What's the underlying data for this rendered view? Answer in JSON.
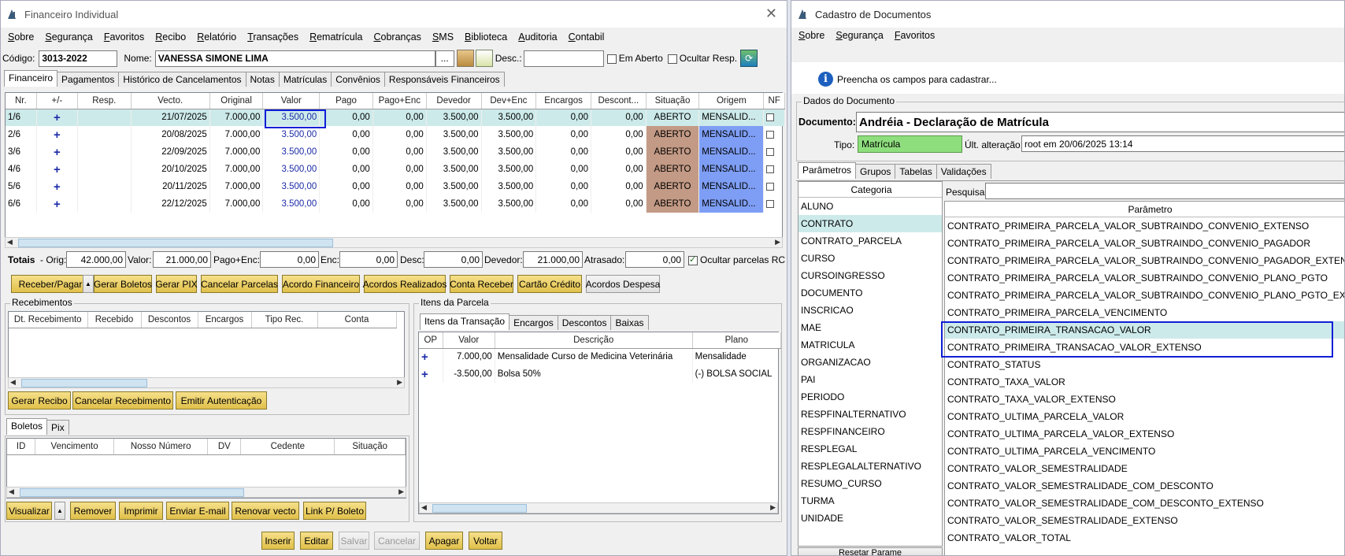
{
  "w1": {
    "title": "Financeiro Individual",
    "menu": [
      "Sobre",
      "Segurança",
      "Favoritos",
      "Recibo",
      "Relatório",
      "Transações",
      "Rematrícula",
      "Cobranças",
      "SMS",
      "Biblioteca",
      "Auditoria",
      "Contabil"
    ],
    "codigo_label": "Código:",
    "codigo": "3013-2022",
    "nome_label": "Nome:",
    "nome": "VANESSA SIMONE LIMA",
    "ellipsis": "...",
    "desc_label": "Desc.:",
    "em_aberto": "Em Aberto",
    "ocultar_resp": "Ocultar Resp.",
    "tabs": [
      "Financeiro",
      "Pagamentos",
      "Histórico de Cancelamentos",
      "Notas",
      "Matrículas",
      "Convênios",
      "Responsáveis Financeiros"
    ],
    "columns": [
      "Nr.",
      "+/-",
      "Resp.",
      "Vecto.",
      "Original",
      "Valor",
      "Pago",
      "Pago+Enc",
      "Devedor",
      "Dev+Enc",
      "Encargos",
      "Descont...",
      "Situação",
      "Origem",
      "NF"
    ],
    "rows": [
      [
        "1/6",
        "+",
        "",
        "21/07/2025",
        "7.000,00",
        "3.500,00",
        "0,00",
        "0,00",
        "3.500,00",
        "3.500,00",
        "0,00",
        "0,00",
        "ABERTO",
        "MENSALID..."
      ],
      [
        "2/6",
        "+",
        "",
        "20/08/2025",
        "7.000,00",
        "3.500,00",
        "0,00",
        "0,00",
        "3.500,00",
        "3.500,00",
        "0,00",
        "0,00",
        "ABERTO",
        "MENSALID..."
      ],
      [
        "3/6",
        "+",
        "",
        "22/09/2025",
        "7.000,00",
        "3.500,00",
        "0,00",
        "0,00",
        "3.500,00",
        "3.500,00",
        "0,00",
        "0,00",
        "ABERTO",
        "MENSALID..."
      ],
      [
        "4/6",
        "+",
        "",
        "20/10/2025",
        "7.000,00",
        "3.500,00",
        "0,00",
        "0,00",
        "3.500,00",
        "3.500,00",
        "0,00",
        "0,00",
        "ABERTO",
        "MENSALID..."
      ],
      [
        "5/6",
        "+",
        "",
        "20/11/2025",
        "7.000,00",
        "3.500,00",
        "0,00",
        "0,00",
        "3.500,00",
        "3.500,00",
        "0,00",
        "0,00",
        "ABERTO",
        "MENSALID..."
      ],
      [
        "6/6",
        "+",
        "",
        "22/12/2025",
        "7.000,00",
        "3.500,00",
        "0,00",
        "0,00",
        "3.500,00",
        "3.500,00",
        "0,00",
        "0,00",
        "ABERTO",
        "MENSALID..."
      ]
    ],
    "totais": {
      "label": "Totais",
      "orig_label": "- Orig:",
      "orig": "42.000,00",
      "valor_label": "Valor:",
      "valor": "21.000,00",
      "pagoenc_label": "Pago+Enc:",
      "pagoenc": "0,00",
      "enc_label": "Enc:",
      "enc": "0,00",
      "desc_label": "Desc:",
      "desc": "0,00",
      "devedor_label": "Devedor:",
      "devedor": "21.000,00",
      "atrasado_label": "Atrasado:",
      "atrasado": "0,00",
      "ocultar": "Ocultar parcelas RC"
    },
    "actions": [
      "Receber/Pagar",
      "Gerar Boletos",
      "Gerar PIX",
      "Cancelar Parcelas",
      "Acordo Financeiro",
      "Acordos Realizados",
      "Conta Receber",
      "Cartão Crédito",
      "Acordos Despesa"
    ],
    "recebimentos": {
      "title": "Recebimentos",
      "columns": [
        "Dt. Recebimento",
        "Recebido",
        "Descontos",
        "Encargos",
        "Tipo Rec.",
        "Conta"
      ]
    },
    "rec_buttons": [
      "Gerar Recibo",
      "Cancelar Recebimento",
      "Emitir Autenticação"
    ],
    "itens": {
      "title": "Itens da Parcela",
      "tabs": [
        "Itens da Transação",
        "Encargos",
        "Descontos",
        "Baixas"
      ],
      "columns": [
        "OP",
        "Valor",
        "Descrição",
        "Plano"
      ],
      "rows": [
        [
          "+",
          "7.000,00",
          "Mensalidade Curso de Medicina Veterinária",
          "Mensalidade"
        ],
        [
          "+",
          "-3.500,00",
          "Bolsa 50%",
          "(-) BOLSA SOCIAL"
        ]
      ]
    },
    "boletos": {
      "tabs": [
        "Boletos",
        "Pix"
      ],
      "columns": [
        "ID",
        "Vencimento",
        "Nosso Número",
        "DV",
        "Cedente",
        "Situação"
      ]
    },
    "bol_buttons": [
      "Visualizar",
      "Remover",
      "Imprimir",
      "Enviar E-mail",
      "Renovar vecto",
      "Link P/ Boleto"
    ],
    "footer_buttons": [
      "Inserir",
      "Editar",
      "Salvar",
      "Cancelar",
      "Apagar",
      "Voltar"
    ]
  },
  "w2": {
    "title": "Cadastro de Documentos",
    "menu": [
      "Sobre",
      "Segurança",
      "Favoritos"
    ],
    "info": "Preencha os campos para cadastrar...",
    "group": "Dados do Documento",
    "doc_label": "Documento:",
    "doc": "Andréia - Declaração de Matrícula",
    "tipo_label": "Tipo:",
    "tipo": "Matrícula",
    "ult_label": "Últ. alteração:",
    "ult": "root em 20/06/2025 13:14",
    "tabs": [
      "Parâmetros",
      "Grupos",
      "Tabelas",
      "Validações"
    ],
    "categoria_header": "Categoria",
    "pesquisar_label": "Pesquisar:",
    "parametro_header": "Parâmetro",
    "categorias": [
      "ALUNO",
      "CONTRATO",
      "CONTRATO_PARCELA",
      "CURSO",
      "CURSOINGRESSO",
      "DOCUMENTO",
      "INSCRICAO",
      "MAE",
      "MATRICULA",
      "ORGANIZACAO",
      "PAI",
      "PERIODO",
      "RESPFINALTERNATIVO",
      "RESPFINANCEIRO",
      "RESPLEGAL",
      "RESPLEGALALTERNATIVO",
      "RESUMO_CURSO",
      "TURMA",
      "UNIDADE"
    ],
    "parametros": [
      "CONTRATO_PRIMEIRA_PARCELA_VALOR_SUBTRAINDO_CONVENIO_EXTENSO",
      "CONTRATO_PRIMEIRA_PARCELA_VALOR_SUBTRAINDO_CONVENIO_PAGADOR",
      "CONTRATO_PRIMEIRA_PARCELA_VALOR_SUBTRAINDO_CONVENIO_PAGADOR_EXTENSO",
      "CONTRATO_PRIMEIRA_PARCELA_VALOR_SUBTRAINDO_CONVENIO_PLANO_PGTO",
      "CONTRATO_PRIMEIRA_PARCELA_VALOR_SUBTRAINDO_CONVENIO_PLANO_PGTO_EXTENSO",
      "CONTRATO_PRIMEIRA_PARCELA_VENCIMENTO",
      "CONTRATO_PRIMEIRA_TRANSACAO_VALOR",
      "CONTRATO_PRIMEIRA_TRANSACAO_VALOR_EXTENSO",
      "CONTRATO_STATUS",
      "CONTRATO_TAXA_VALOR",
      "CONTRATO_TAXA_VALOR_EXTENSO",
      "CONTRATO_ULTIMA_PARCELA_VALOR",
      "CONTRATO_ULTIMA_PARCELA_VALOR_EXTENSO",
      "CONTRATO_ULTIMA_PARCELA_VENCIMENTO",
      "CONTRATO_VALOR_SEMESTRALIDADE",
      "CONTRATO_VALOR_SEMESTRALIDADE_COM_DESCONTO",
      "CONTRATO_VALOR_SEMESTRALIDADE_COM_DESCONTO_EXTENSO",
      "CONTRATO_VALOR_SEMESTRALIDADE_EXTENSO",
      "CONTRATO_VALOR_TOTAL"
    ],
    "bottom_btn": "Resetar Parame"
  }
}
